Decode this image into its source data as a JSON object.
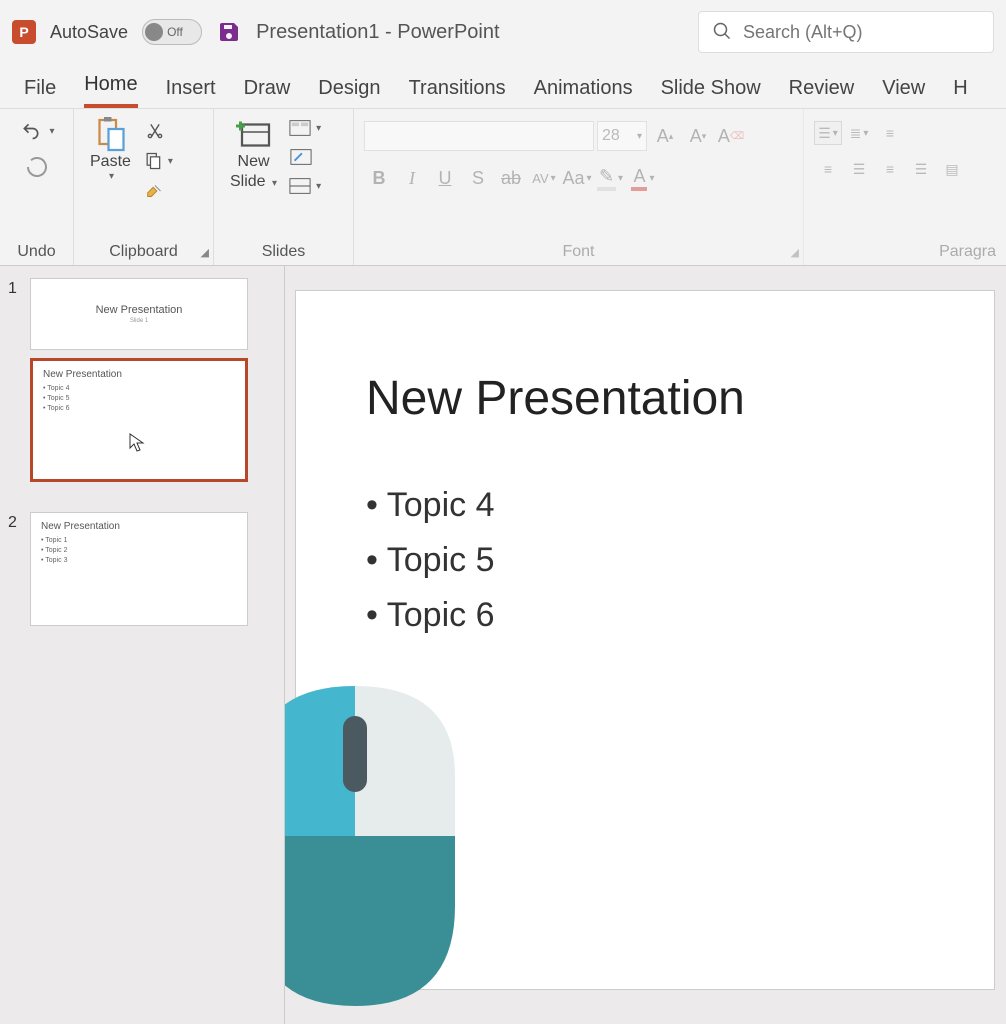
{
  "title_bar": {
    "app_letter": "P",
    "autosave_label": "AutoSave",
    "autosave_state": "Off",
    "document_title": "Presentation1  -  PowerPoint",
    "search_placeholder": "Search (Alt+Q)"
  },
  "tabs": {
    "file": "File",
    "home": "Home",
    "insert": "Insert",
    "draw": "Draw",
    "design": "Design",
    "transitions": "Transitions",
    "animations": "Animations",
    "slide_show": "Slide Show",
    "review": "Review",
    "view": "View",
    "help": "H"
  },
  "ribbon": {
    "undo_label": "Undo",
    "clipboard_label": "Clipboard",
    "paste_label": "Paste",
    "slides_label": "Slides",
    "new_slide_label_line1": "New",
    "new_slide_label_line2": "Slide",
    "font_label": "Font",
    "font_size": "28",
    "paragraph_label": "Paragra"
  },
  "thumbnails": {
    "n1": "1",
    "n2": "2",
    "title_slide_title": "New Presentation",
    "title_slide_sub": "Slide 1",
    "slide1_title": "New Presentation",
    "slide1_t1": "Topic 4",
    "slide1_t2": "Topic 5",
    "slide1_t3": "Topic 6",
    "slide2_title": "New Presentation",
    "slide2_t1": "Topic 1",
    "slide2_t2": "Topic 2",
    "slide2_t3": "Topic 3"
  },
  "slide": {
    "title": "New Presentation",
    "bullet1": "Topic 4",
    "bullet2": "Topic 5",
    "bullet3": "Topic 6"
  }
}
